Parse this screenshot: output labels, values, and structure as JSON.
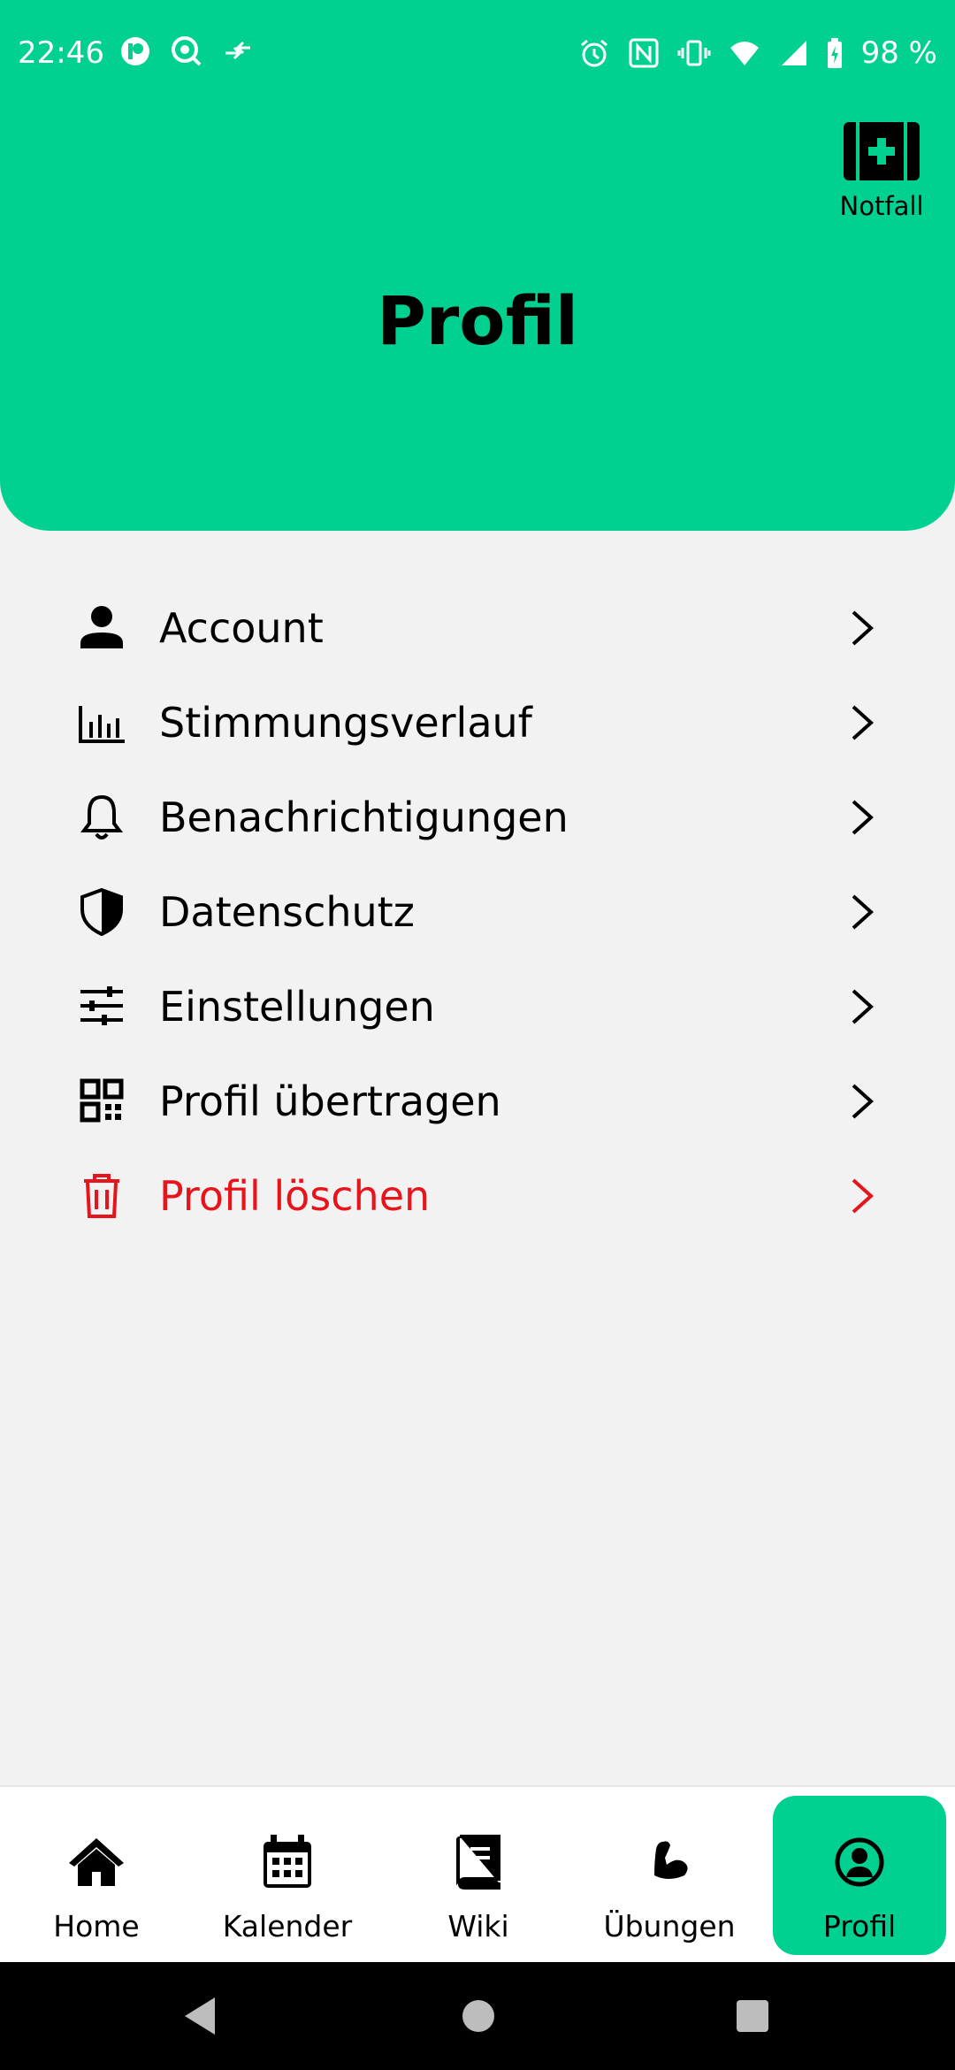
{
  "status_bar": {
    "time": "22:46",
    "battery": "98 %",
    "icons": [
      "app-icon",
      "search-app-icon",
      "transfer-icon",
      "alarm-icon",
      "nfc-icon",
      "vibrate-icon",
      "wifi-icon",
      "signal-icon",
      "battery-icon"
    ]
  },
  "header": {
    "title": "Profil",
    "emergency_label": "Notfall",
    "color": "#00d090"
  },
  "menu": {
    "items": [
      {
        "label": "Account",
        "icon": "person-icon"
      },
      {
        "label": "Stimmungsverlauf",
        "icon": "chart-icon"
      },
      {
        "label": "Benachrichtigungen",
        "icon": "bell-icon"
      },
      {
        "label": "Datenschutz",
        "icon": "shield-icon"
      },
      {
        "label": "Einstellungen",
        "icon": "sliders-icon"
      },
      {
        "label": "Profil übertragen",
        "icon": "qr-code-icon"
      },
      {
        "label": "Profil löschen",
        "icon": "trash-icon",
        "color": "#e8141b"
      }
    ]
  },
  "bottom_nav": {
    "items": [
      {
        "label": "Home",
        "icon": "home-icon"
      },
      {
        "label": "Kalender",
        "icon": "calendar-icon"
      },
      {
        "label": "Wiki",
        "icon": "book-icon"
      },
      {
        "label": "Übungen",
        "icon": "muscle-icon"
      },
      {
        "label": "Profil",
        "icon": "profile-circle-icon",
        "active": true
      }
    ]
  }
}
